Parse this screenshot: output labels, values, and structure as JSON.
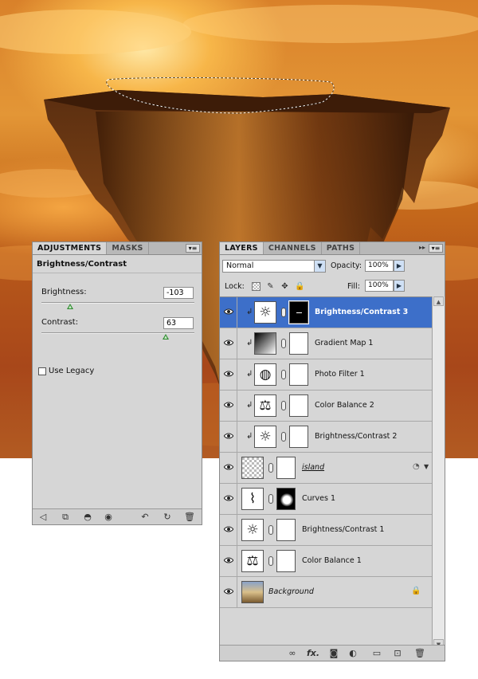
{
  "adjustments_panel": {
    "tabs": [
      "ADJUSTMENTS",
      "MASKS"
    ],
    "menu_icon": "panel-menu-icon",
    "title": "Brightness/Contrast",
    "brightness": {
      "label": "Brightness:",
      "value": "-103",
      "slider_fraction": 0.19
    },
    "contrast": {
      "label": "Contrast:",
      "value": "63",
      "slider_fraction": 0.81
    },
    "use_legacy": {
      "label": "Use Legacy",
      "checked": false
    },
    "bottom_icons": [
      "return-to-list-icon",
      "expanded-view-icon",
      "clip-to-layer-icon",
      "visibility-eye-icon",
      "previous-state-icon",
      "reset-icon",
      "trash-icon"
    ]
  },
  "layers_panel": {
    "tabs": [
      "LAYERS",
      "CHANNELS",
      "PATHS"
    ],
    "blend_mode": "Normal",
    "opacity": {
      "label": "Opacity:",
      "value": "100%"
    },
    "lock": {
      "label": "Lock:"
    },
    "fill": {
      "label": "Fill:",
      "value": "100%"
    },
    "layers": [
      {
        "name": "Brightness/Contrast 3",
        "icon": "brightness-contrast-adjustment-icon",
        "clipped": true,
        "mask": "black",
        "selected": true
      },
      {
        "name": "Gradient Map 1",
        "icon": "gradient-map-adjustment-icon",
        "clipped": true,
        "mask": "white",
        "selected": false
      },
      {
        "name": "Photo Filter 1",
        "icon": "photo-filter-adjustment-icon",
        "clipped": true,
        "mask": "white",
        "selected": false
      },
      {
        "name": "Color Balance 2",
        "icon": "color-balance-adjustment-icon",
        "clipped": true,
        "mask": "white",
        "selected": false
      },
      {
        "name": "Brightness/Contrast 2",
        "icon": "brightness-contrast-adjustment-icon",
        "clipped": true,
        "mask": "white",
        "selected": false
      },
      {
        "name": "island",
        "icon": "smart-object-thumbnail",
        "clipped": false,
        "mask": "white",
        "selected": false
      },
      {
        "name": "Curves 1",
        "icon": "curves-adjustment-icon",
        "clipped": false,
        "mask": "black-with-white",
        "selected": false
      },
      {
        "name": "Brightness/Contrast 1",
        "icon": "brightness-contrast-adjustment-icon",
        "clipped": false,
        "mask": "white",
        "selected": false
      },
      {
        "name": "Color Balance 1",
        "icon": "color-balance-adjustment-icon",
        "clipped": false,
        "mask": "white",
        "selected": false
      },
      {
        "name": "Background",
        "icon": "photo-thumbnail",
        "clipped": false,
        "mask": "none",
        "selected": false
      }
    ],
    "bottom_icons": [
      "link-layers-icon",
      "layer-style-fx-icon",
      "add-mask-icon",
      "new-adjustment-layer-icon",
      "new-group-icon",
      "new-layer-icon",
      "trash-icon"
    ],
    "fx_label": "fx."
  },
  "colors": {
    "panel_bg": "#d6d6d6",
    "selection_blue": "#3d6fc9",
    "slider_thumb": "#2f8a2f"
  }
}
